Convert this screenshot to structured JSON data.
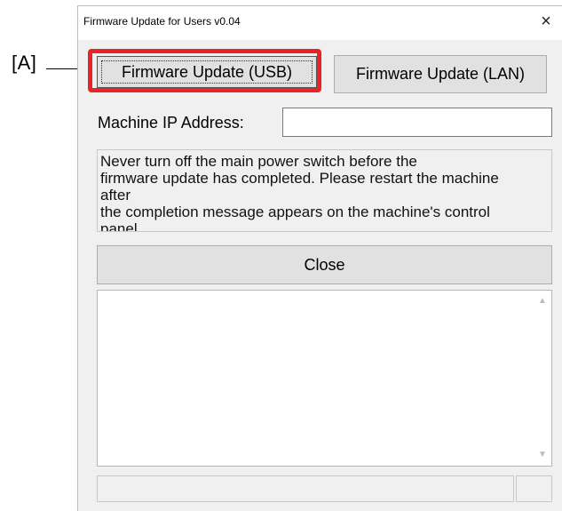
{
  "annotation": {
    "callout_label": "[A]",
    "highlight_color": "#e8232a"
  },
  "window": {
    "title": "Firmware Update for Users v0.04",
    "close_glyph": "×"
  },
  "buttons": {
    "usb_label": "Firmware Update (USB)",
    "lan_label": "Firmware Update (LAN)",
    "close_label": "Close"
  },
  "ip_address": {
    "label": "Machine IP Address:",
    "value": ""
  },
  "message": {
    "lines": [
      "Never turn off the main power switch before the",
      "firmware update has completed. Please restart the machine",
      "after",
      "the completion message appears on the machine's control",
      "panel."
    ]
  },
  "log": {
    "scroll_up_icon": "chevron-up",
    "scroll_down_icon": "chevron-down"
  }
}
